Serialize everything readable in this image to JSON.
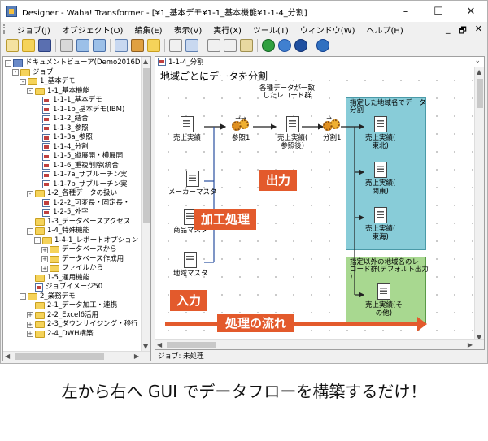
{
  "window": {
    "title": "Designer - Waha! Transformer - [¥1_基本デモ¥1-1_基本機能¥1-1-4_分割]",
    "minimize": "–",
    "maximize": "☐",
    "close": "✕"
  },
  "menu": {
    "items": [
      "ジョブ(J)",
      "オブジェクト(O)",
      "編集(E)",
      "表示(V)",
      "実行(X)",
      "ツール(T)",
      "ウィンドウ(W)",
      "ヘルプ(H)"
    ],
    "right_minimize": "_",
    "right_restore": "🗗",
    "right_close": "✕"
  },
  "tree": {
    "rows": [
      {
        "label": "ドキュメントビューア(Demo2016DBA)",
        "indent": 0,
        "icon": "root",
        "toggle": "-"
      },
      {
        "label": "ジョブ",
        "indent": 1,
        "icon": "folder",
        "toggle": "-"
      },
      {
        "label": "1_基本デモ",
        "indent": 2,
        "icon": "folder",
        "toggle": "-"
      },
      {
        "label": "1-1_基本機能",
        "indent": 3,
        "icon": "folder",
        "toggle": "-"
      },
      {
        "label": "1-1-1_基本デモ",
        "indent": 4,
        "icon": "job",
        "toggle": ""
      },
      {
        "label": "1-1-1b_基本デモ(IBM)",
        "indent": 4,
        "icon": "job",
        "toggle": ""
      },
      {
        "label": "1-1-2_結合",
        "indent": 4,
        "icon": "job",
        "toggle": ""
      },
      {
        "label": "1-1-3_参照",
        "indent": 4,
        "icon": "job",
        "toggle": ""
      },
      {
        "label": "1-1-3a_参照",
        "indent": 4,
        "icon": "job",
        "toggle": ""
      },
      {
        "label": "1-1-4_分割",
        "indent": 4,
        "icon": "job",
        "toggle": ""
      },
      {
        "label": "1-1-5_縦展開・横展開",
        "indent": 4,
        "icon": "job",
        "toggle": ""
      },
      {
        "label": "1-1-6_重複削除(統合",
        "indent": 4,
        "icon": "job",
        "toggle": ""
      },
      {
        "label": "1-1-7a_サブルーチン実",
        "indent": 4,
        "icon": "job",
        "toggle": ""
      },
      {
        "label": "1-1-7b_サブルーチン実",
        "indent": 4,
        "icon": "job",
        "toggle": ""
      },
      {
        "label": "1-2_各種データの扱い",
        "indent": 3,
        "icon": "folder",
        "toggle": "-"
      },
      {
        "label": "1-2-2_可変長・固定長・",
        "indent": 4,
        "icon": "job",
        "toggle": ""
      },
      {
        "label": "1-2-5_外字",
        "indent": 4,
        "icon": "job",
        "toggle": ""
      },
      {
        "label": "1-3_データベースアクセス",
        "indent": 3,
        "icon": "folder",
        "toggle": ""
      },
      {
        "label": "1-4_特殊機能",
        "indent": 3,
        "icon": "folder",
        "toggle": "-"
      },
      {
        "label": "1-4-1_レポートオプション",
        "indent": 4,
        "icon": "folder",
        "toggle": "-"
      },
      {
        "label": "データベースから",
        "indent": 5,
        "icon": "folder",
        "toggle": "+"
      },
      {
        "label": "データベース作成用",
        "indent": 5,
        "icon": "folder",
        "toggle": "+"
      },
      {
        "label": "ファイルから",
        "indent": 5,
        "icon": "folder",
        "toggle": "+"
      },
      {
        "label": "1-5_運用機能",
        "indent": 3,
        "icon": "folder",
        "toggle": ""
      },
      {
        "label": "ジョブイメージ50",
        "indent": 3,
        "icon": "job",
        "toggle": ""
      },
      {
        "label": "2_業務デモ",
        "indent": 2,
        "icon": "folder",
        "toggle": "-"
      },
      {
        "label": "2-1_データ加工・連携",
        "indent": 3,
        "icon": "folder",
        "toggle": ""
      },
      {
        "label": "2-2_Excel6活用",
        "indent": 3,
        "icon": "folder",
        "toggle": "+"
      },
      {
        "label": "2-3_ダウンサイジング・移行",
        "indent": 3,
        "icon": "folder",
        "toggle": "+"
      },
      {
        "label": "2-4_DWH構築",
        "indent": 3,
        "icon": "folder",
        "toggle": "+"
      }
    ]
  },
  "editor": {
    "tab_label": "1-1-4_分割",
    "canvas_title": "地域ごとにデータを分割",
    "nodes": {
      "uriage": "売上実績",
      "maker": "メーカーマスタ",
      "shohin": "商品マスタ",
      "chiiki": "地域マスタ",
      "sansho": "参照1",
      "note_top": "各種データが一致\nしたレコード群",
      "uriage_sansho": "売上実績(\n参照後)",
      "bunkatsu": "分割1",
      "east": "売上実績(\n東北)",
      "kanto": "売上実績(\n関東)",
      "tokai": "売上実績(\n東海)",
      "other": "売上実績(そ\nの他)"
    },
    "panel_blue_label": "指定した地域名でデータ\n分割",
    "panel_green_label": "指定以外の地域名のレ\nコード群(デフォルト出力\n)"
  },
  "callouts": {
    "shutsuryoku": "出力",
    "kako": "加工処理",
    "nyuryoku": "入力",
    "flow": "処理の流れ"
  },
  "status": "ジョブ: 未処理",
  "caption": "左から右へ GUI でデータフローを構築するだけ！"
}
